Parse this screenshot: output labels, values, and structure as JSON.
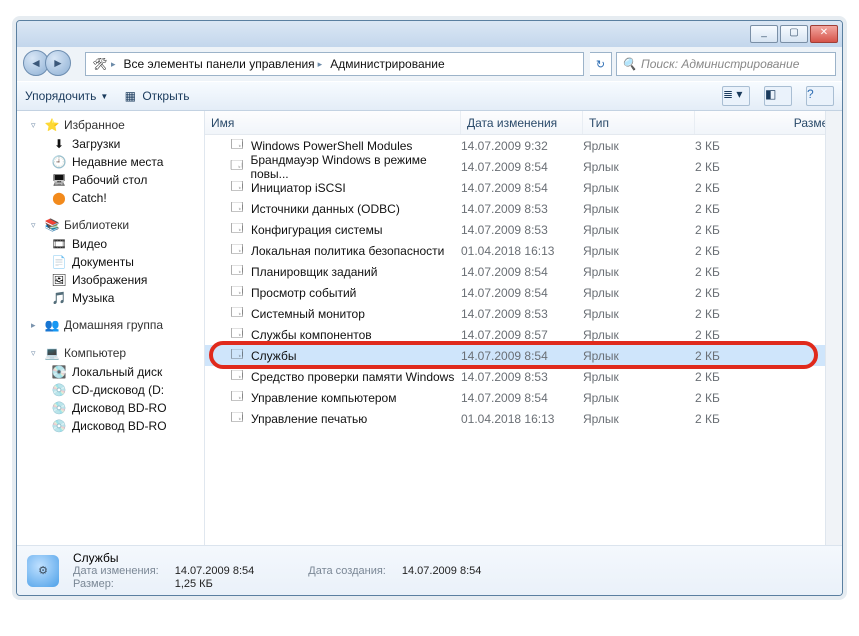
{
  "titlebar": {
    "min": "_",
    "max": "▢",
    "close": "✕"
  },
  "address": {
    "seg1": "Все элементы панели управления",
    "seg2": "Администрирование"
  },
  "search": {
    "placeholder": "Поиск: Администрирование"
  },
  "toolbar": {
    "organize": "Упорядочить",
    "open": "Открыть"
  },
  "nav": {
    "favorites": {
      "label": "Избранное",
      "items": [
        "Загрузки",
        "Недавние места",
        "Рабочий стол",
        "Catch!"
      ]
    },
    "libraries": {
      "label": "Библиотеки",
      "items": [
        "Видео",
        "Документы",
        "Изображения",
        "Музыка"
      ]
    },
    "homegroup": {
      "label": "Домашняя группа"
    },
    "computer": {
      "label": "Компьютер",
      "items": [
        "Локальный диск",
        "CD-дисковод (D:",
        "Дисковод BD-RO",
        "Дисковод BD-RO"
      ]
    }
  },
  "columns": {
    "name": "Имя",
    "date": "Дата изменения",
    "type": "Тип",
    "size": "Размер"
  },
  "rows": [
    {
      "name": "Windows PowerShell Modules",
      "date": "14.07.2009 9:32",
      "type": "Ярлык",
      "size": "3 КБ"
    },
    {
      "name": "Брандмауэр Windows в режиме повы...",
      "date": "14.07.2009 8:54",
      "type": "Ярлык",
      "size": "2 КБ"
    },
    {
      "name": "Инициатор iSCSI",
      "date": "14.07.2009 8:54",
      "type": "Ярлык",
      "size": "2 КБ"
    },
    {
      "name": "Источники данных (ODBC)",
      "date": "14.07.2009 8:53",
      "type": "Ярлык",
      "size": "2 КБ"
    },
    {
      "name": "Конфигурация системы",
      "date": "14.07.2009 8:53",
      "type": "Ярлык",
      "size": "2 КБ"
    },
    {
      "name": "Локальная политика безопасности",
      "date": "01.04.2018 16:13",
      "type": "Ярлык",
      "size": "2 КБ"
    },
    {
      "name": "Планировщик заданий",
      "date": "14.07.2009 8:54",
      "type": "Ярлык",
      "size": "2 КБ"
    },
    {
      "name": "Просмотр событий",
      "date": "14.07.2009 8:54",
      "type": "Ярлык",
      "size": "2 КБ"
    },
    {
      "name": "Системный монитор",
      "date": "14.07.2009 8:53",
      "type": "Ярлык",
      "size": "2 КБ"
    },
    {
      "name": "Службы компонентов",
      "date": "14.07.2009 8:57",
      "type": "Ярлык",
      "size": "2 КБ"
    },
    {
      "name": "Службы",
      "date": "14.07.2009 8:54",
      "type": "Ярлык",
      "size": "2 КБ",
      "selected": true
    },
    {
      "name": "Средство проверки памяти Windows",
      "date": "14.07.2009 8:53",
      "type": "Ярлык",
      "size": "2 КБ"
    },
    {
      "name": "Управление компьютером",
      "date": "14.07.2009 8:54",
      "type": "Ярлык",
      "size": "2 КБ"
    },
    {
      "name": "Управление печатью",
      "date": "01.04.2018 16:13",
      "type": "Ярлык",
      "size": "2 КБ"
    }
  ],
  "details": {
    "title": "Службы",
    "mod_lbl": "Дата изменения:",
    "mod_val": "14.07.2009 8:54",
    "size_lbl": "Размер:",
    "size_val": "1,25 КБ",
    "created_lbl": "Дата создания:",
    "created_val": "14.07.2009 8:54"
  }
}
